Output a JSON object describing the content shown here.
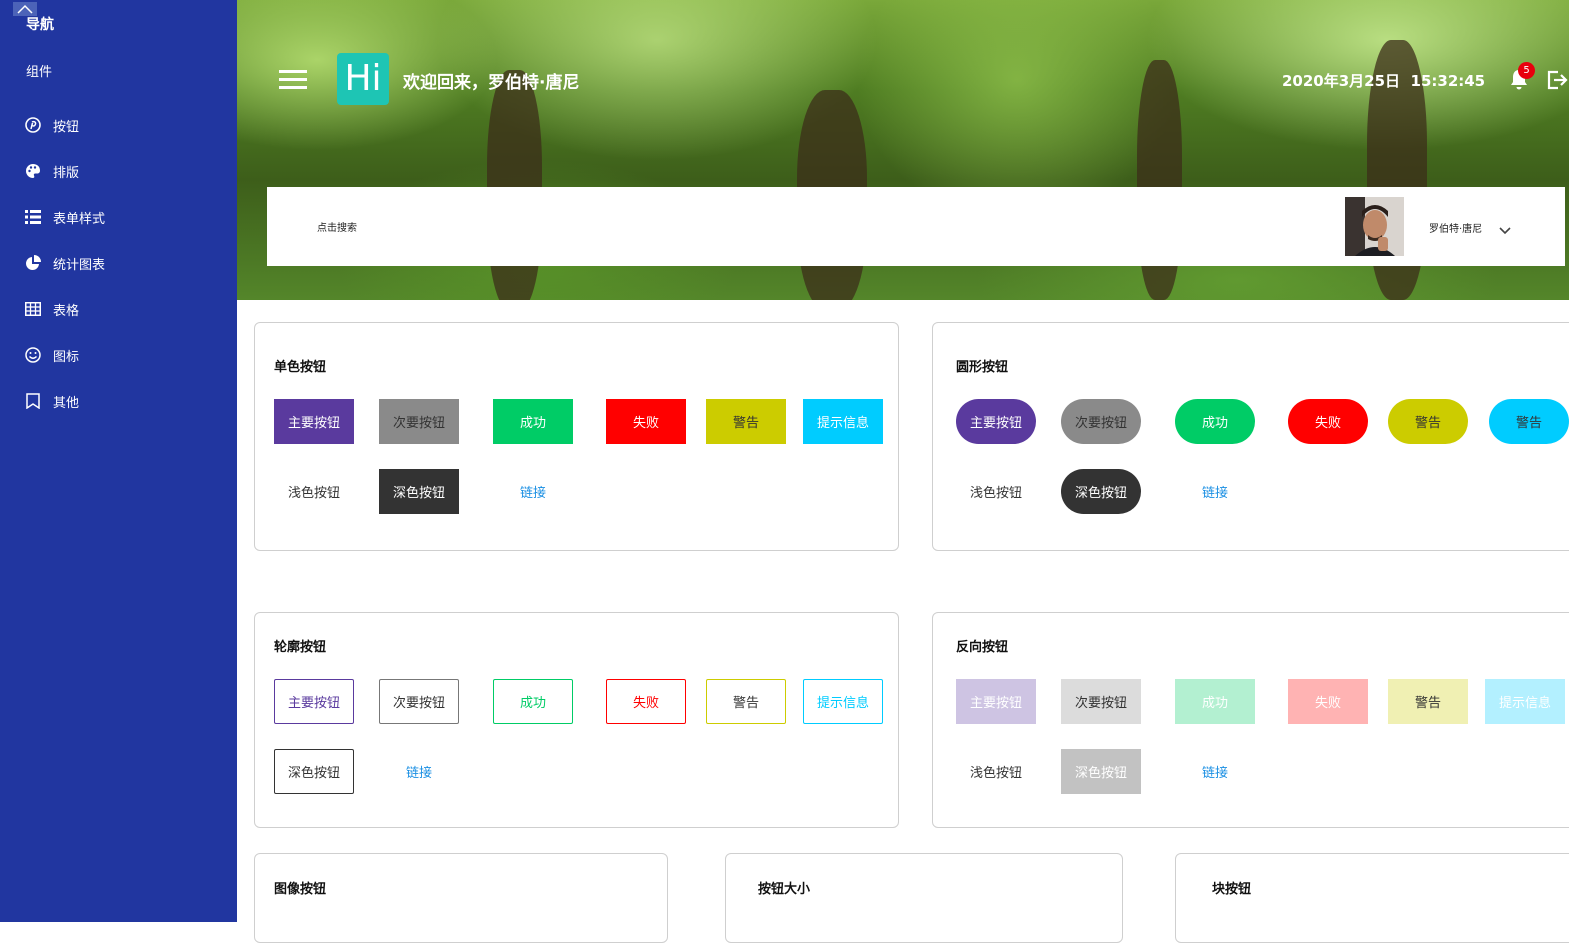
{
  "sidebar": {
    "title": "导航",
    "subtitle": "组件",
    "items": [
      {
        "label": "按钮",
        "icon": "pinterest-icon"
      },
      {
        "label": "排版",
        "icon": "palette-icon"
      },
      {
        "label": "表单样式",
        "icon": "list-icon"
      },
      {
        "label": "统计图表",
        "icon": "pie-chart-icon"
      },
      {
        "label": "表格",
        "icon": "table-icon"
      },
      {
        "label": "图标",
        "icon": "smile-icon"
      },
      {
        "label": "其他",
        "icon": "bookmark-icon"
      }
    ]
  },
  "header": {
    "logo": "Hi",
    "welcome": "欢迎回来，罗伯特·唐尼",
    "datetime": "2020年3月25日  15:32:45",
    "notification_count": "5",
    "search_label": "点击搜索",
    "user_name": "罗伯特·唐尼"
  },
  "cards": {
    "solid": {
      "title": "单色按钮",
      "buttons": [
        "主要按钮",
        "次要按钮",
        "成功",
        "失败",
        "警告",
        "提示信息",
        "浅色按钮",
        "深色按钮",
        "链接"
      ]
    },
    "round": {
      "title": "圆形按钮",
      "buttons": [
        "主要按钮",
        "次要按钮",
        "成功",
        "失败",
        "警告",
        "警告",
        "浅色按钮",
        "深色按钮",
        "链接"
      ]
    },
    "outline": {
      "title": "轮廓按钮",
      "buttons": [
        "主要按钮",
        "次要按钮",
        "成功",
        "失败",
        "警告",
        "提示信息",
        "深色按钮",
        "链接"
      ]
    },
    "inverse": {
      "title": "反向按钮",
      "buttons": [
        "主要按钮",
        "次要按钮",
        "成功",
        "失败",
        "警告",
        "提示信息",
        "浅色按钮",
        "深色按钮",
        "链接"
      ]
    },
    "image": {
      "title": "图像按钮"
    },
    "size": {
      "title": "按钮大小"
    },
    "block": {
      "title": "块按钮"
    }
  },
  "colors": {
    "sidebar": "#2136a0",
    "primary": "#5a3a9e",
    "secondary": "#8a8a8a",
    "success": "#00cc66",
    "danger": "#ff0000",
    "warning": "#cccc00",
    "info": "#00ccff",
    "dark": "#333333",
    "link": "#1a8fe3"
  }
}
